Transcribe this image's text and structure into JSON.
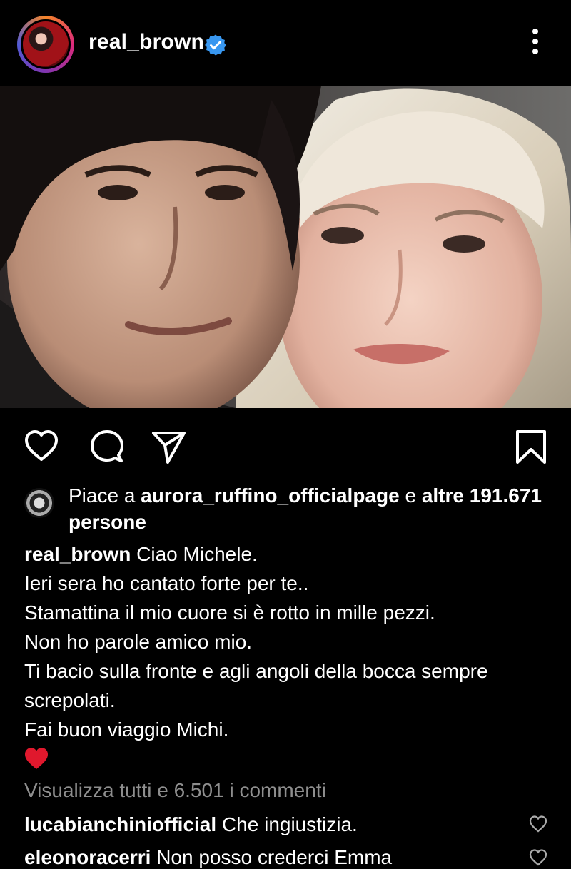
{
  "header": {
    "username": "real_brown",
    "verified_icon": "verified-badge-icon",
    "more_icon": "more-vertical-icon"
  },
  "post": {
    "photo_icon": "post-photo"
  },
  "actions": {
    "like_icon": "heart-outline-icon",
    "comment_icon": "comment-bubble-icon",
    "share_icon": "paper-plane-icon",
    "save_icon": "bookmark-icon"
  },
  "likes": {
    "prefix": "Piace a ",
    "user": "aurora_ruffino_officialpage",
    "middle": " e ",
    "rest": "altre 191.671 persone"
  },
  "caption": {
    "username": "real_brown",
    "first_line": " Ciao Michele.",
    "lines": [
      "Ieri sera ho cantato forte per te..",
      "Stamattina il mio cuore si è rotto in mille pezzi.",
      "Non ho parole amico mio.",
      "Ti bacio sulla fronte e agli angoli della bocca sempre screpolati.",
      "Fai buon viaggio Michi."
    ],
    "emoji": "red-heart-emoji"
  },
  "comments": {
    "view_all": "Visualizza tutti e 6.501 i commenti",
    "items": [
      {
        "user": "lucabianchiniofficial",
        "text": " Che ingiustizia."
      },
      {
        "user": "eleonoracerri",
        "text": " Non posso crederci Emma"
      }
    ]
  },
  "colors": {
    "background": "#000000",
    "text": "#ffffff",
    "muted": "#8e8e8e",
    "verified": "#3897f0",
    "heart": "#e0182d"
  }
}
